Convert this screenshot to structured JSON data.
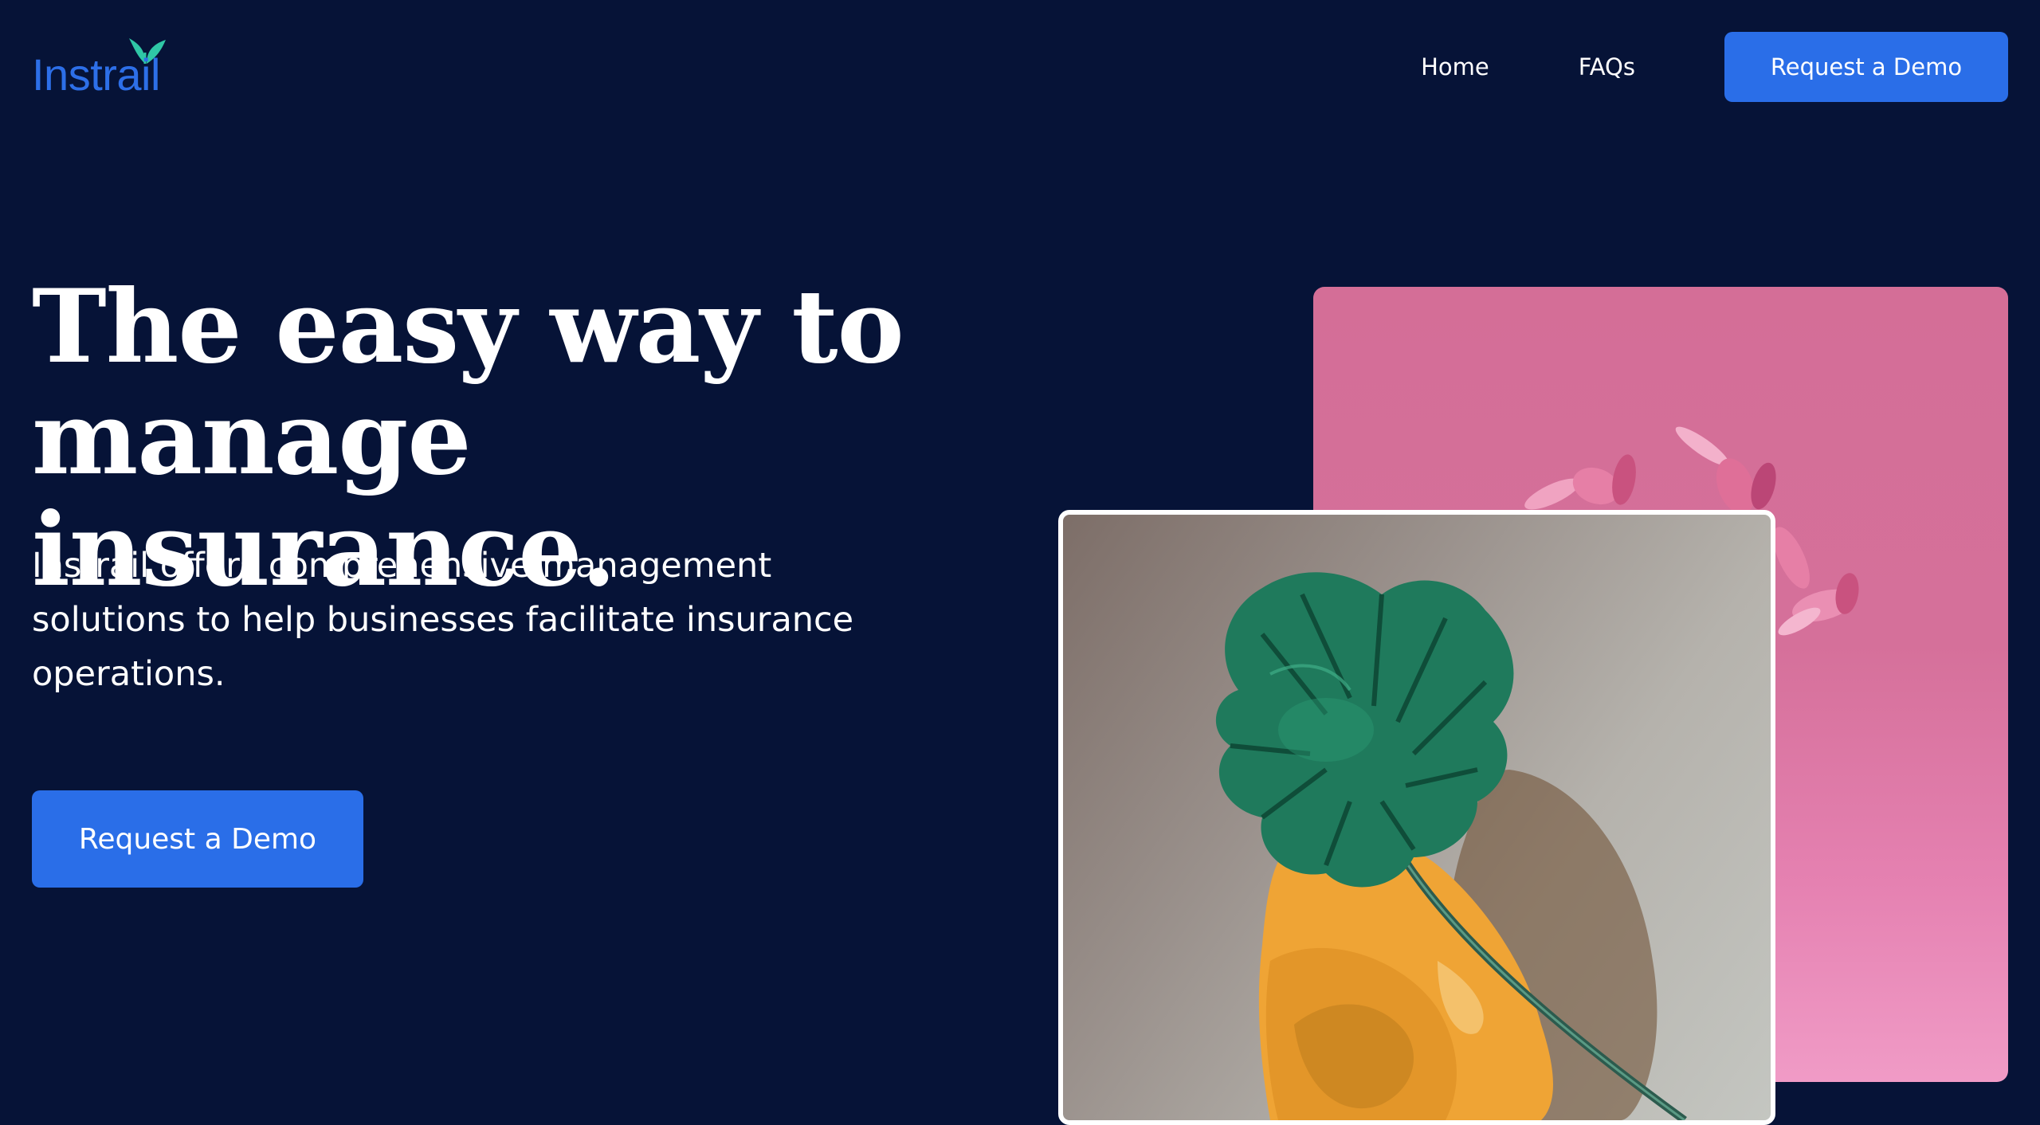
{
  "brand": {
    "name": "Instrail",
    "accent": "#2a6ee8",
    "leaf_color": "#2fc7a6",
    "background": "#061337"
  },
  "nav": {
    "items": [
      {
        "label": "Home"
      },
      {
        "label": "FAQs"
      }
    ],
    "cta_label": "Request a Demo"
  },
  "hero": {
    "title": "The easy way to manage insurance.",
    "subtitle": "Instrail offers comprehensive management solutions to help businesses facilitate insurance operations.",
    "cta_label": "Request a Demo"
  },
  "images": {
    "back": {
      "icon": "pink-petals-photo"
    },
    "front": {
      "icon": "monstera-leaf-on-yellow-chair-photo"
    }
  }
}
